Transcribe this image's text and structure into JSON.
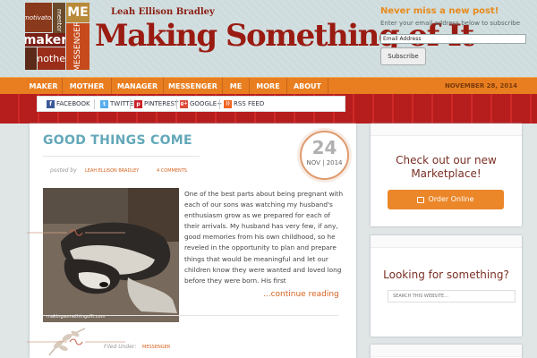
{
  "header": {
    "logo_words": [
      "motivator",
      "mentor",
      "ME",
      "maker",
      "MESSENGER",
      "mother"
    ],
    "byline": "Leah Ellison Bradley",
    "site_title": "Making Something of It"
  },
  "subscribe": {
    "title": "Never miss a new post!",
    "text": "Enter your email address below to subscribe",
    "email_placeholder": "Email Address",
    "button_label": "Subscribe"
  },
  "nav": {
    "items": [
      "MAKER",
      "MOTHER",
      "MANAGER",
      "MESSENGER",
      "ME",
      "MORE",
      "ABOUT"
    ],
    "date": "NOVEMBER 28, 2014"
  },
  "social": {
    "items": [
      {
        "label": "FACEBOOK",
        "icon": "facebook-icon",
        "glyph": "f",
        "color": "#3b5998"
      },
      {
        "label": "TWITTER",
        "icon": "twitter-icon",
        "glyph": "t",
        "color": "#55acee"
      },
      {
        "label": "PINTEREST",
        "icon": "pinterest-icon",
        "glyph": "p",
        "color": "#cb2027"
      },
      {
        "label": "GOOGLE+",
        "icon": "google-plus-icon",
        "glyph": "g+",
        "color": "#dd4b39"
      },
      {
        "label": "RSS FEED",
        "icon": "rss-icon",
        "glyph": "))",
        "color": "#f26522"
      }
    ]
  },
  "post": {
    "title": "GOOD THINGS COME",
    "posted_by": "posted by",
    "author": "LEAH ELLISON BRADLEY",
    "comments": "4 COMMENTS",
    "date_day": "24",
    "date_rest": "NOV | 2014",
    "photo_caption": "makingsomethingofit.com",
    "excerpt": "One of the best parts about being pregnant with each of our sons was watching my husband's enthusiasm grow as we prepared for each of their arrivals. My husband has very few, if any, good memories from his own childhood, so he reveled in the opportunity to plan and prepare things that would be meaningful and let our children know they were wanted and loved long before they were born. His first",
    "read_more": "...continue reading",
    "filed_under": "Filed Under:",
    "category": "MESSENGER"
  },
  "sidebar": {
    "marketplace_heading": "Check out our new Marketplace!",
    "order_button": "Order Online",
    "search_heading": "Looking for something?",
    "search_placeholder": "SEARCH THIS WEBSITE..."
  },
  "colors": {
    "accent_orange": "#e97e20",
    "title_red": "#9a1b12",
    "post_title_teal": "#63a8b9",
    "link_orange": "#d4621f"
  }
}
